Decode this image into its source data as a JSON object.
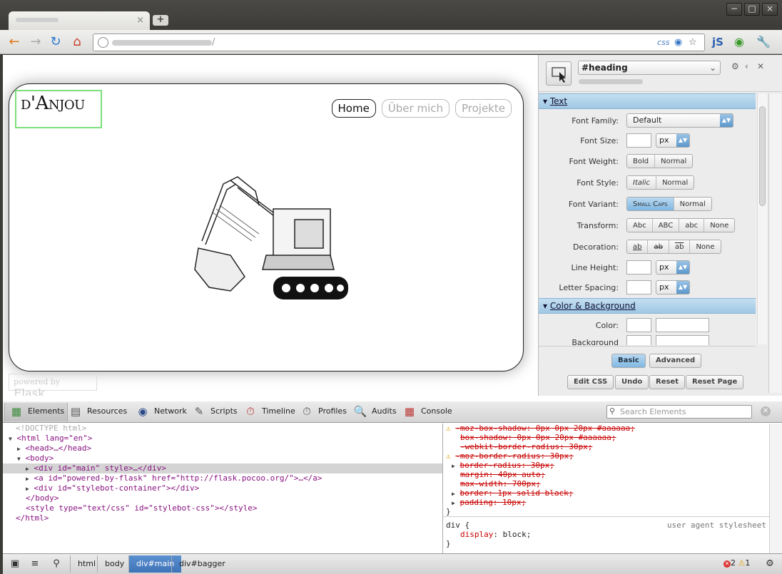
{
  "browser": {
    "tab_close": "×",
    "new_tab": "+",
    "window_controls": {
      "minimize": "−",
      "maximize": "□",
      "close": "×"
    },
    "url_suffix": "/",
    "omnibox_css_badge": "css",
    "icons": [
      "back-arrow-icon",
      "forward-arrow-icon",
      "reload-icon",
      "home-icon",
      "globe-icon",
      "css-icon",
      "star-icon",
      "js-icon",
      "extension-icon",
      "wrench-icon"
    ]
  },
  "page": {
    "logo": "d'Anjou",
    "nav": [
      "Home",
      "Über mich",
      "Projekte"
    ],
    "flask_badge": {
      "prefix": "powered by",
      "name": "Flask"
    }
  },
  "stylebot": {
    "selector": "#heading",
    "sections": {
      "text": "Text",
      "color": "Color & Background"
    },
    "rows": {
      "font_family": {
        "label": "Font Family:",
        "value": "Default"
      },
      "font_size": {
        "label": "Font Size:",
        "unit": "px"
      },
      "font_weight": {
        "label": "Font Weight:",
        "options": [
          "Bold",
          "Normal"
        ]
      },
      "font_style": {
        "label": "Font Style:",
        "options": [
          "Italic",
          "Normal"
        ]
      },
      "font_variant": {
        "label": "Font Variant:",
        "options": [
          "Small Caps",
          "Normal"
        ],
        "selected": "Small Caps"
      },
      "transform": {
        "label": "Transform:",
        "options": [
          "Abc",
          "ABC",
          "abc",
          "None"
        ]
      },
      "decoration": {
        "label": "Decoration:",
        "options": [
          "ab",
          "ab",
          "ab",
          "None"
        ]
      },
      "line_height": {
        "label": "Line Height:",
        "unit": "px"
      },
      "letter_spacing": {
        "label": "Letter Spacing:",
        "unit": "px"
      },
      "color": {
        "label": "Color:"
      },
      "background": {
        "label": "Background"
      }
    },
    "footer": {
      "basic": "Basic",
      "advanced": "Advanced",
      "edit_css": "Edit CSS",
      "undo": "Undo",
      "reset": "Reset",
      "reset_page": "Reset Page"
    }
  },
  "devtools": {
    "tabs": [
      "Elements",
      "Resources",
      "Network",
      "Scripts",
      "Timeline",
      "Profiles",
      "Audits",
      "Console"
    ],
    "search_placeholder": "Search Elements",
    "dom": {
      "doctype": "<!DOCTYPE html>",
      "html_open": "<html lang=\"en\">",
      "head": "<head>…</head>",
      "body_open": "<body>",
      "div_main": "<div id=\"main\" style>…</div>",
      "a_flask": "<a id=\"powered-by-flask\" href=\"http://flask.pocoo.org/\">…</a>",
      "div_stylebot": "<div id=\"stylebot-container\"></div>",
      "body_close": "</body>",
      "style": "<style type=\"text/css\" id=\"stylebot-css\"></style>",
      "html_close": "</html>"
    },
    "styles": [
      {
        "text": "-moz-box-shadow: 0px 0px 20px #aaaaaa;",
        "struck": true,
        "warn": true
      },
      {
        "text": "box-shadow: 0px 0px 20px #aaaaaa;",
        "struck": true
      },
      {
        "text": "-webkit-border-radius: 30px;",
        "struck": true
      },
      {
        "text": "-moz-border-radius: 30px;",
        "struck": true,
        "warn": true
      },
      {
        "text": "border-radius: 30px;",
        "struck": true,
        "arrow": true
      },
      {
        "text": "margin: 40px auto;",
        "struck": true
      },
      {
        "text": "max-width: 700px;",
        "struck": true
      },
      {
        "text": "border: 1px solid black;",
        "struck": true,
        "arrow": true
      },
      {
        "text": "padding: 10px;",
        "struck": true,
        "arrow": true
      }
    ],
    "styles_close": "}",
    "ua_rule": {
      "selector": "div {",
      "source": "user agent stylesheet",
      "decl_prop": "display",
      "decl_val": "block;",
      "close": "}"
    },
    "breadcrumbs": [
      "html",
      "body",
      "div#main",
      "div#bagger"
    ],
    "selected_crumb": "div#main",
    "errors": "2",
    "warnings": "1"
  }
}
